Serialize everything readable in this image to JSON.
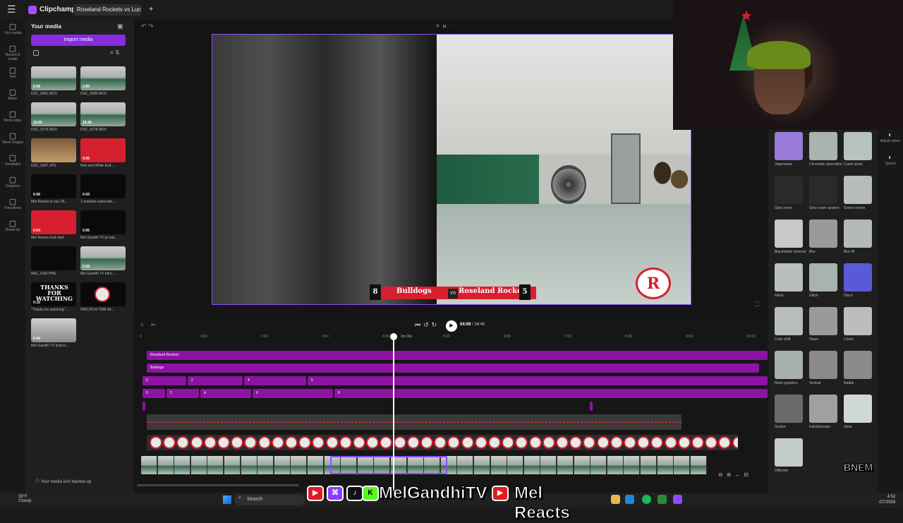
{
  "app": {
    "name": "Clipchamp",
    "project_title": "Roseland Rockets vs Lucky L"
  },
  "rail": [
    {
      "label": "Your media",
      "icon": "folder-icon"
    },
    {
      "label": "Record & create",
      "icon": "camera-icon"
    },
    {
      "label": "Text",
      "icon": "text-icon"
    },
    {
      "label": "Music",
      "icon": "music-icon"
    },
    {
      "label": "Stock video",
      "icon": "film-icon"
    },
    {
      "label": "Stock images",
      "icon": "image-icon"
    },
    {
      "label": "Templates",
      "icon": "template-icon"
    },
    {
      "label": "Graphics",
      "icon": "shapes-icon"
    },
    {
      "label": "Transitions",
      "icon": "transition-icon"
    },
    {
      "label": "Brand kit",
      "icon": "brand-icon"
    }
  ],
  "media": {
    "title": "Your media",
    "import_label": "Import media",
    "items": [
      {
        "name": "DSC_0081.MOV",
        "dur": "5:09",
        "style": "gym"
      },
      {
        "name": "DSC_0080.MOV",
        "dur": "1:05",
        "style": "gym"
      },
      {
        "name": "DSC_0079.MOV",
        "dur": "14:50",
        "style": "gym"
      },
      {
        "name": "DSC_0078.MOV",
        "dur": "15:40",
        "style": "gym"
      },
      {
        "name": "DSC_0007.JPG",
        "dur": "",
        "style": "brown"
      },
      {
        "name": "Red and White End ...",
        "dur": "0:05",
        "style": "red"
      },
      {
        "name": "Mel Reacts-yt-sku-18...",
        "dur": "0:06",
        "style": "blk"
      },
      {
        "name": "1-youtube-subscribe...",
        "dur": "0:03",
        "style": "blk"
      },
      {
        "name": "Mel Reacts End.mp4",
        "dur": "0:04",
        "style": "red"
      },
      {
        "name": "Mel Gandhi TV-yt-sub...",
        "dur": "0:05",
        "style": "blk"
      },
      {
        "name": "IMG_1003.PNG",
        "dur": "",
        "style": "blk"
      },
      {
        "name": "Mel Gandhi TV Intro ...",
        "dur": "0:08",
        "style": "gym"
      },
      {
        "name": "\"Thanks for watching\" ...",
        "dur": "0:10",
        "style": "blk"
      },
      {
        "name": "594C2F24-7998-48...",
        "dur": "",
        "style": "blk"
      },
      {
        "name": "Mel Gandhi TV End.m...",
        "dur": "0:04",
        "style": "gray"
      }
    ],
    "thanks_text": "THANKS FOR WATCHING",
    "backup_text": "Your media isn't backed up"
  },
  "preview": {
    "score_left": "8",
    "team_left": "Bulldogs",
    "vs": "VS",
    "team_right": "Roseland Rockets",
    "score_right": "5",
    "logo_letter": "R"
  },
  "effects": [
    {
      "name": "Vaporwave",
      "color": "#9a7ad8"
    },
    {
      "name": "Chromatic aberration",
      "color": "#aab3ae"
    },
    {
      "name": "Crash zoom",
      "color": "#b9c3bd"
    },
    {
      "name": "Slow zoom",
      "color": "#2a2a2a"
    },
    {
      "name": "Slow zoom random",
      "color": "#2a2a2a"
    },
    {
      "name": "Green screen",
      "color": "#b6bcb8"
    },
    {
      "name": "Black/white removal",
      "color": "#c8c8c8"
    },
    {
      "name": "Blur",
      "color": "#9a9a9a"
    },
    {
      "name": "Blur fill",
      "color": "#b3bab6"
    },
    {
      "name": "Filmic",
      "color": "#b9c0bc"
    },
    {
      "name": "Glitch",
      "color": "#a8b3ad"
    },
    {
      "name": "Disco",
      "color": "#5a5ad8"
    },
    {
      "name": "Color shift",
      "color": "#b8bfbb"
    },
    {
      "name": "Glass",
      "color": "#9a9a9a"
    },
    {
      "name": "Comic",
      "color": "#bdbdbd"
    },
    {
      "name": "Retro graphics",
      "color": "#a7b1ac"
    },
    {
      "name": "Vertical",
      "color": "#8a8a8a"
    },
    {
      "name": "Radial",
      "color": "#8a8a8a"
    },
    {
      "name": "Smoke",
      "color": "#6a6a6a"
    },
    {
      "name": "Kaleidoscope",
      "color": "#a0a0a0"
    },
    {
      "name": "Glow",
      "color": "#d0d8d3"
    },
    {
      "name": "Diffusion",
      "color": "#c4ccc7"
    }
  ],
  "props": [
    {
      "label": "Adjust colors",
      "icon": "adjust-colors-icon"
    },
    {
      "label": "Speed",
      "icon": "speed-icon"
    }
  ],
  "timeline": {
    "current_time": "04:09",
    "total_time": "/ 34:40",
    "playhead_label": "2m 00s",
    "ruler": [
      "0",
      "1:00",
      "2:00",
      "3:00",
      "4:00",
      "5:00",
      "6:00",
      "7:00",
      "8:00",
      "9:00",
      "10:00"
    ],
    "text_tracks": [
      {
        "label": "Roseland Rockets"
      },
      {
        "label": "Bulldogs"
      }
    ],
    "score_tracks": [
      [
        "0",
        "2",
        "4",
        "5"
      ],
      [
        "0",
        "2",
        "4",
        "6",
        "8"
      ]
    ]
  },
  "taskbar": {
    "temp": "39°F",
    "weather": "Cloudy",
    "search": "Search",
    "time": "4:52",
    "date": "/27/2025"
  },
  "banner": {
    "channel1": "MelGandhiTV",
    "channel2": "Mel Reacts",
    "tag": "BNEM"
  }
}
